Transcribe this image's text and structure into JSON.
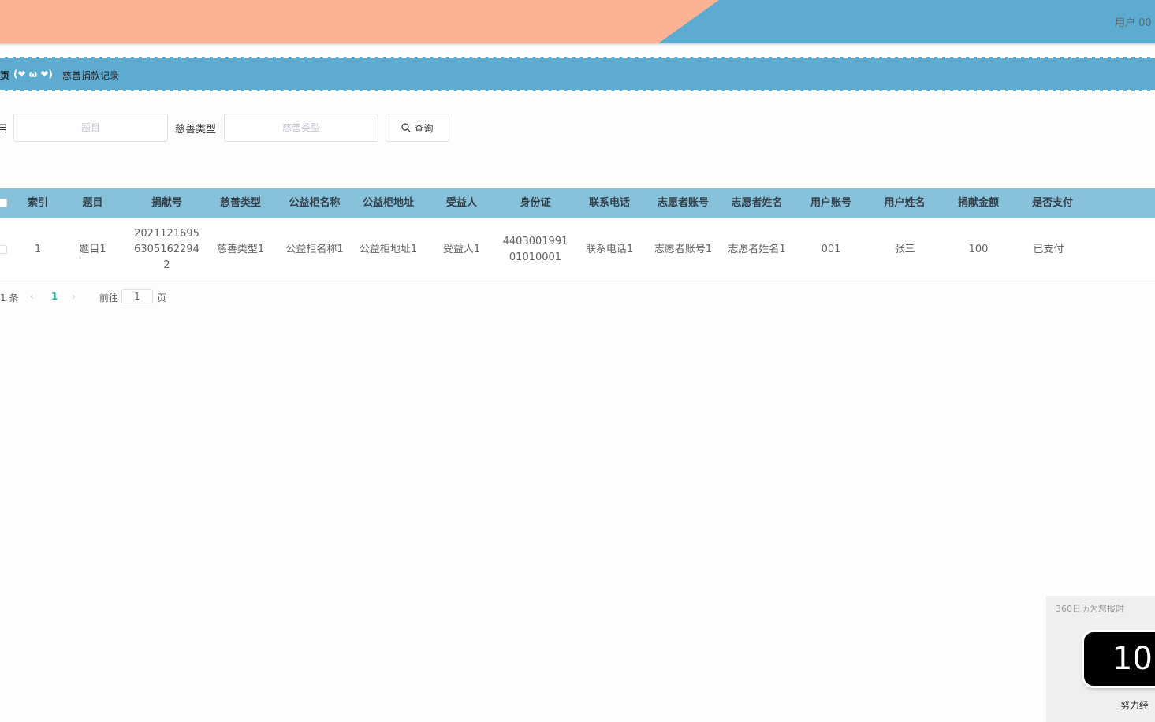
{
  "header": {
    "user_text": "用户 00",
    "accent_color": "#5eabd1",
    "wedge_color": "#fdb393"
  },
  "breadcrumb": {
    "home": "页",
    "separator": "(❤ ω ❤)",
    "current": "慈善捐款记录"
  },
  "search": {
    "field1_label": "目",
    "field1_placeholder": "题目",
    "field2_label": "慈善类型",
    "field2_placeholder": "慈善类型",
    "query_button": "查询",
    "query_icon": "search-icon"
  },
  "table": {
    "columns": [
      "索引",
      "题目",
      "捐献号",
      "慈善类型",
      "公益柜名称",
      "公益柜地址",
      "受益人",
      "身份证",
      "联系电话",
      "志愿者账号",
      "志愿者姓名",
      "用户账号",
      "用户姓名",
      "捐献金额",
      "是否支付"
    ],
    "rows": [
      [
        "1",
        "题目1",
        "2021121695 6305162294 2",
        "慈善类型1",
        "公益柜名称1",
        "公益柜地址1",
        "受益人1",
        "4403001991 01010001",
        "联系电话1",
        "志愿者账号1",
        "志愿者姓名1",
        "001",
        "张三",
        "100",
        "已支付"
      ]
    ]
  },
  "pagination": {
    "total_text": "1 条",
    "prev_icon": "chevron-left-icon",
    "current_page": "1",
    "next_icon": "chevron-right-icon",
    "goto_label": "前往",
    "goto_value": "1",
    "goto_suffix": "页"
  },
  "widget": {
    "title": "360日历为您报时",
    "clock_value": "10",
    "footer": "努力经"
  }
}
